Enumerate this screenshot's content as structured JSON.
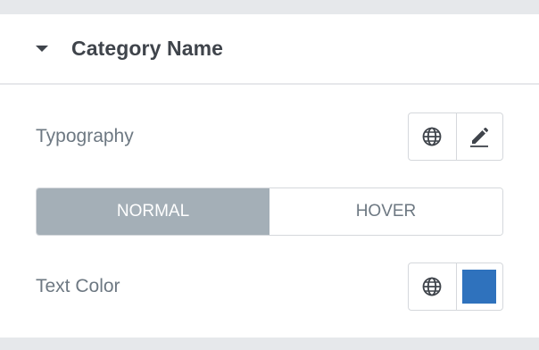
{
  "section": {
    "title": "Category Name",
    "icon": "caret-down-icon"
  },
  "typography": {
    "label": "Typography",
    "global_icon": "globe-icon",
    "edit_icon": "pencil-icon"
  },
  "state_tabs": {
    "normal_label": "NORMAL",
    "hover_label": "HOVER",
    "active": "normal"
  },
  "text_color": {
    "label": "Text Color",
    "global_icon": "globe-icon",
    "swatch_color": "#2f72bd"
  },
  "colors": {
    "background": "#e6e8eb",
    "label": "#6d7882",
    "title": "#3f444b",
    "active_tab": "#a4afb7"
  }
}
